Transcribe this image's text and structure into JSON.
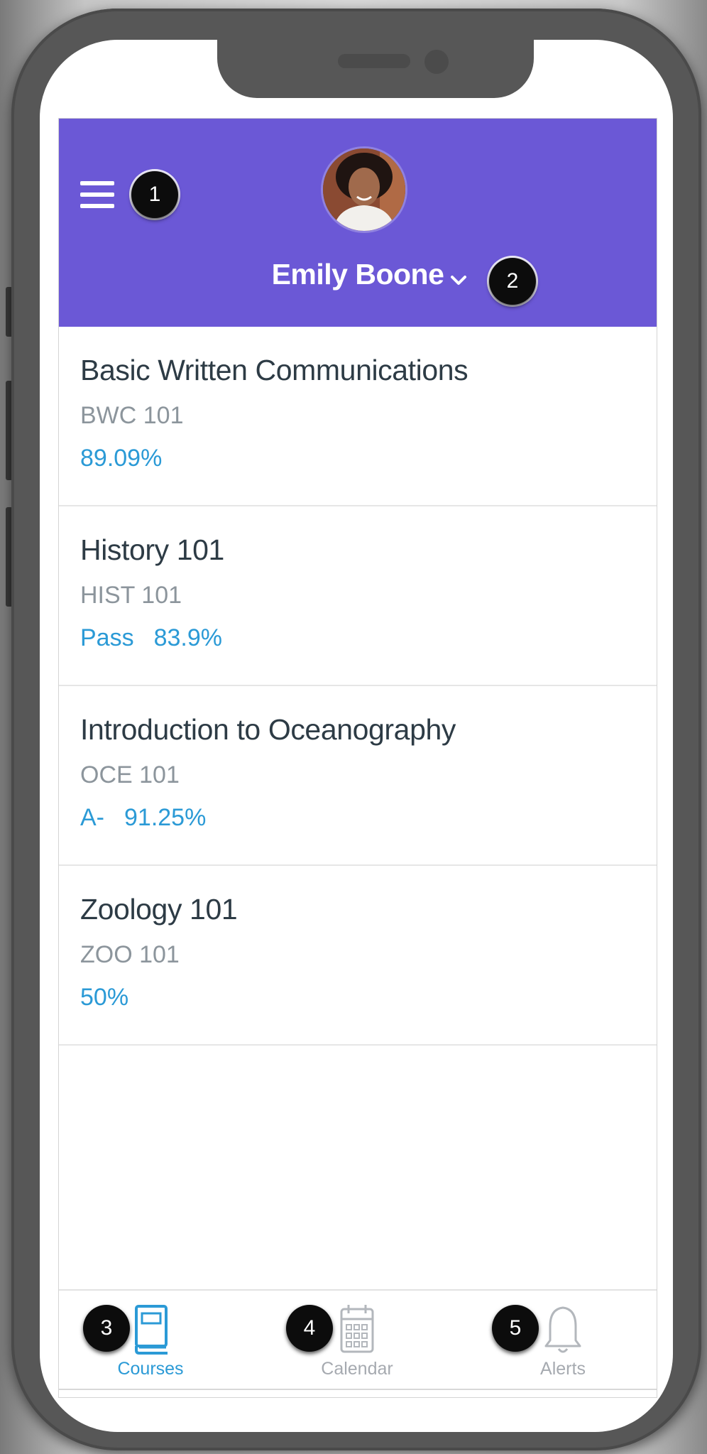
{
  "header": {
    "user_name": "Emily Boone",
    "menu_icon": "hamburger-menu-icon",
    "dropdown_icon": "chevron-down-icon",
    "color": "#6b58d6"
  },
  "courses": [
    {
      "name": "Basic Written Communications",
      "code": "BWC 101",
      "grade_letter": "",
      "grade_percent": "89.09%"
    },
    {
      "name": "History 101",
      "code": "HIST 101",
      "grade_letter": "Pass",
      "grade_percent": "83.9%"
    },
    {
      "name": "Introduction to Oceanography",
      "code": "OCE 101",
      "grade_letter": "A-",
      "grade_percent": "91.25%"
    },
    {
      "name": "Zoology 101",
      "code": "ZOO 101",
      "grade_letter": "",
      "grade_percent": "50%"
    }
  ],
  "tabs": [
    {
      "label": "Courses",
      "icon": "book-icon",
      "active": true
    },
    {
      "label": "Calendar",
      "icon": "calendar-icon",
      "active": false
    },
    {
      "label": "Alerts",
      "icon": "bell-icon",
      "active": false
    }
  ],
  "callouts": [
    "1",
    "2",
    "3",
    "4",
    "5"
  ],
  "colors": {
    "accent": "#2b9ad6",
    "inactive": "#a6aab0",
    "text": "#2d3b45"
  }
}
